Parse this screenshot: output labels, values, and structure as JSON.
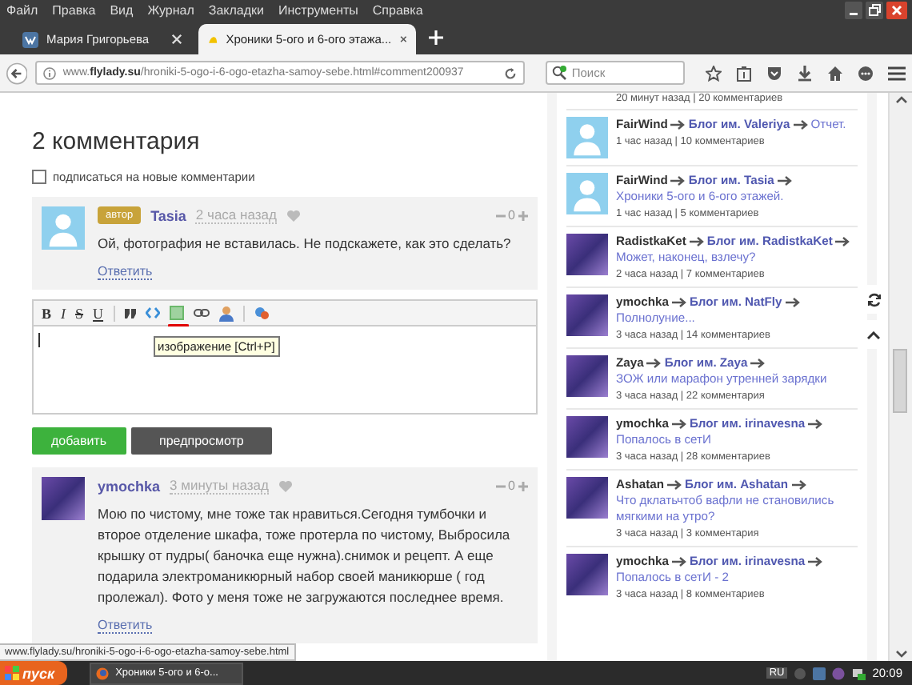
{
  "menu_bar": {
    "items": [
      "Файл",
      "Правка",
      "Вид",
      "Журнал",
      "Закладки",
      "Инструменты",
      "Справка"
    ]
  },
  "tabs": [
    {
      "label": "Мария Григорьева",
      "kind": "vk",
      "selected": false
    },
    {
      "label": "Хроники 5-ого и 6-ого этажа...",
      "kind": "site",
      "selected": true
    }
  ],
  "address_bar": {
    "url": "www.**flylady.su**/hroniki-5-ogo-i-6-ogo-etazha-samoy-sebe.html#comment200937",
    "search_placeholder": "Поиск"
  },
  "comments_section": {
    "heading": "2 комментария",
    "subscribe": {
      "label": "подписаться на новые комментарии",
      "checked": false
    },
    "comments": [
      {
        "author": "Tasia",
        "badge": "автор",
        "kind": "default",
        "time": "2 часа назад",
        "text": "Ой, фотография не вставилась. Не подскажете, как это сделать?",
        "score": "0",
        "reply": "Ответить"
      }
    ],
    "editor": {
      "toolbar": [
        {
          "kind": "text",
          "label": "B"
        },
        {
          "kind": "text",
          "label": "I"
        },
        {
          "kind": "text",
          "label": "S"
        },
        {
          "kind": "text",
          "label": "U"
        },
        {
          "kind": "quote"
        },
        {
          "kind": "code"
        },
        {
          "kind": "image"
        },
        {
          "kind": "link"
        },
        {
          "kind": "user"
        },
        {
          "kind": "special"
        }
      ],
      "tooltip": "изображение [Ctrl+P]",
      "submit": "добавить",
      "preview": "предпросмотр"
    },
    "replies": [
      {
        "author": "ymochka",
        "kind": "photo",
        "time": "3 минуты назад",
        "text": "Мою по чистому, мне тоже так нравиться.Сегодня тумбочки и второе отделение шкафа, тоже протерла по чистому, Выбросила крышку от пудры( баночка еще нужна).снимок и рецепт. А еще подарила электроманикюрный набор своей маникюрше ( год пролежал). Фото у меня тоже не загружаются последнее время.",
        "score": "0",
        "reply": "Ответить"
      }
    ]
  },
  "sidebar": {
    "first_item_meta": "20 минут назад | 20 комментариев",
    "items": [
      {
        "author": "FairWind",
        "blog": "Блог им. Valeriya",
        "post": "Отчет.",
        "meta": "1 час назад | 10 комментариев",
        "kind": "default"
      },
      {
        "author": "FairWind",
        "blog": "Блог им. Tasia",
        "post": "Хроники 5-ого и 6-ого этажей.",
        "meta": "1 час назад | 5 комментариев",
        "kind": "default"
      },
      {
        "author": "RadistkaKet",
        "blog": "Блог им. RadistkaKet",
        "post": "Может, наконец, взлечу?",
        "meta": "2 часа назад | 7 комментариев",
        "kind": "photo"
      },
      {
        "author": "ymochka",
        "blog": "Блог им. NatFly",
        "post": "Полнолуние...",
        "meta": "3 часа назад | 14 комментариев",
        "kind": "photo"
      },
      {
        "author": "Zaya",
        "blog": "Блог им. Zaya",
        "post": "ЗОЖ или марафон утренней зарядки",
        "meta": "3 часа назад | 22 комментария",
        "kind": "photo"
      },
      {
        "author": "ymochka",
        "blog": "Блог им. irinavesna",
        "post": "Попалось в сетИ",
        "meta": "3 часа назад | 28 комментариев",
        "kind": "photo"
      },
      {
        "author": "Ashatan",
        "blog": "Блог им. Ashatan",
        "post": "Что дклатьчтоб вафли не становились мягкими на утро?",
        "meta": "3 часа назад | 3 комментария",
        "kind": "photo"
      },
      {
        "author": "ymochka",
        "blog": "Блог им. irinavesna",
        "post": "Попалось в сетИ - 2",
        "meta": "3 часа назад | 8 комментариев",
        "kind": "photo"
      }
    ]
  },
  "status_url": "www.flylady.su/hroniki-5-ogo-i-6-ogo-etazha-samoy-sebe.html",
  "taskbar": {
    "start": "пуск",
    "task": "Хроники 5-ого и 6-о...",
    "language": "RU",
    "clock": "20:09"
  }
}
